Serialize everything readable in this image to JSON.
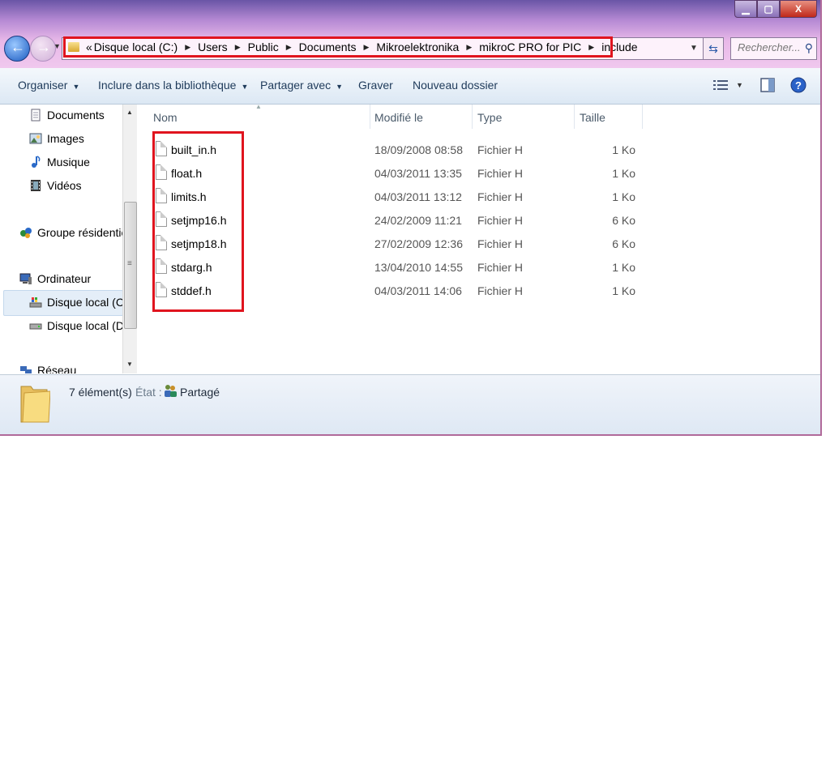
{
  "address": {
    "overflow_chevron": "«",
    "crumbs": [
      "Disque local (C:)",
      "Users",
      "Public",
      "Documents",
      "Mikroelektronika",
      "mikroC PRO for PIC",
      "include"
    ]
  },
  "search": {
    "placeholder": "Rechercher..."
  },
  "window_controls": {
    "close": "X"
  },
  "toolbar": {
    "organize": "Organiser",
    "include_library": "Inclure dans la bibliothèque",
    "share_with": "Partager avec",
    "burn": "Graver",
    "new_folder": "Nouveau dossier"
  },
  "nav": {
    "documents": "Documents",
    "images": "Images",
    "music": "Musique",
    "videos": "Vidéos",
    "homegroup": "Groupe résidentiel",
    "computer": "Ordinateur",
    "disk_c": "Disque local (C:)",
    "disk_d": "Disque local (D:)",
    "network": "Réseau"
  },
  "columns": {
    "name": "Nom",
    "modified": "Modifié le",
    "type": "Type",
    "size": "Taille"
  },
  "files": [
    {
      "name": "built_in.h",
      "modified": "18/09/2008 08:58",
      "type": "Fichier H",
      "size": "1 Ko"
    },
    {
      "name": "float.h",
      "modified": "04/03/2011 13:35",
      "type": "Fichier H",
      "size": "1 Ko"
    },
    {
      "name": "limits.h",
      "modified": "04/03/2011 13:12",
      "type": "Fichier H",
      "size": "1 Ko"
    },
    {
      "name": "setjmp16.h",
      "modified": "24/02/2009 11:21",
      "type": "Fichier H",
      "size": "6 Ko"
    },
    {
      "name": "setjmp18.h",
      "modified": "27/02/2009 12:36",
      "type": "Fichier H",
      "size": "6 Ko"
    },
    {
      "name": "stdarg.h",
      "modified": "13/04/2010 14:55",
      "type": "Fichier H",
      "size": "1 Ko"
    },
    {
      "name": "stddef.h",
      "modified": "04/03/2011 14:06",
      "type": "Fichier H",
      "size": "1 Ko"
    }
  ],
  "status": {
    "count": "7 élément(s)",
    "state_label": "État :",
    "state_value": "Partagé"
  },
  "colors": {
    "highlight": "#e0141e",
    "titlebar": "#b68ad4",
    "toolbar": "#dce8f4"
  }
}
